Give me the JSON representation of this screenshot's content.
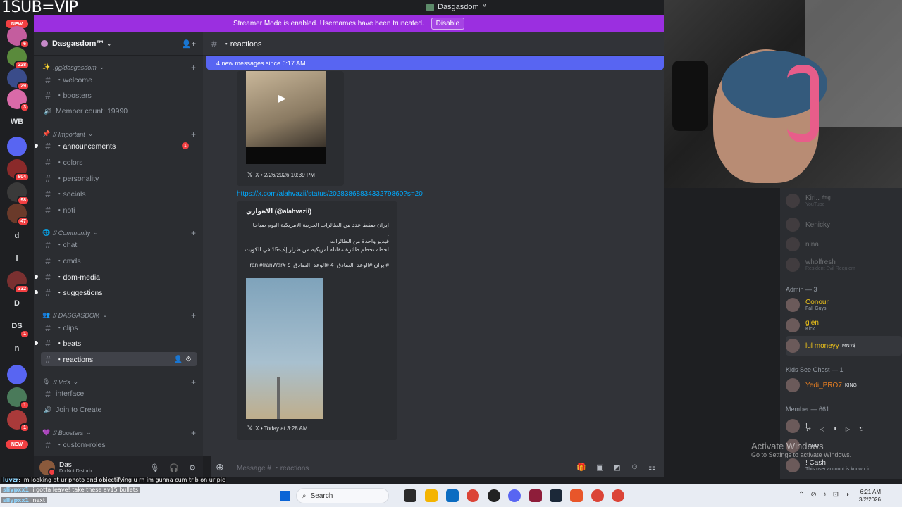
{
  "overlay": {
    "sub_text": "1SUB=VIP",
    "chat_lines": [
      {
        "user": "luvzr",
        "text": "im looking at ur photo and objectifying u rn im gunna cum trib on ur pic"
      },
      {
        "user": "sliypxx1",
        "text": "i gotta leave! take these av15 bullets"
      },
      {
        "user": "sliypxx1",
        "text": "next"
      }
    ]
  },
  "window": {
    "title": "Dasgasdom™"
  },
  "banner": {
    "text": "Streamer Mode is enabled. Usernames have been truncated.",
    "button": "Disable"
  },
  "rail": {
    "new_top": "NEW",
    "new_bottom": "NEW",
    "servers": [
      {
        "label": "",
        "badge": "6",
        "color": "#c45d9e"
      },
      {
        "label": "",
        "badge": "228",
        "color": "#5a8a3c"
      },
      {
        "label": "",
        "badge": "29",
        "color": "#3a4c8a"
      },
      {
        "label": "",
        "badge": "3",
        "color": "#d96aa8"
      },
      {
        "label": "WB",
        "badge": "",
        "color": "transparent"
      },
      {
        "label": "",
        "badge": "",
        "color": "#5865f2"
      },
      {
        "label": "",
        "badge": "804",
        "color": "#8a2a2a"
      },
      {
        "label": "",
        "badge": "98",
        "color": "#3a3a3a"
      },
      {
        "label": "",
        "badge": "47",
        "color": "#6a3a2a"
      },
      {
        "label": "d",
        "badge": "",
        "color": "transparent"
      },
      {
        "label": "l",
        "badge": "",
        "color": "transparent"
      },
      {
        "label": "",
        "badge": "332",
        "color": "#7a3030"
      },
      {
        "label": "D",
        "badge": "",
        "color": "transparent"
      },
      {
        "label": "DS",
        "badge": "1",
        "color": "transparent"
      },
      {
        "label": "n",
        "badge": "",
        "color": "transparent"
      },
      {
        "label": "",
        "badge": "",
        "color": "#5865f2"
      },
      {
        "label": "",
        "badge": "1",
        "color": "#4a7a5a"
      },
      {
        "label": "",
        "badge": "1",
        "color": "#aa3a3a"
      }
    ]
  },
  "guild": {
    "name": "Dasgasdom™",
    "categories": [
      {
        "name": ".gg/dasgasdom",
        "icon": "✨"
      },
      {
        "name": "// Important",
        "icon": "📌"
      },
      {
        "name": "// Community",
        "icon": "🌐"
      },
      {
        "name": "// DASGASDOM",
        "icon": "👥"
      },
      {
        "name": "// Vc's",
        "icon": "🎙"
      },
      {
        "name": "// Boosters",
        "icon": "💜"
      }
    ],
    "channels": [
      {
        "name": "・welcome",
        "type": "text"
      },
      {
        "name": "・boosters",
        "type": "text"
      },
      {
        "name": "Member count: 19990",
        "type": "voice"
      },
      {
        "name": "・announcements",
        "type": "text",
        "mention": "1"
      },
      {
        "name": "・colors",
        "type": "text"
      },
      {
        "name": "・personality",
        "type": "text"
      },
      {
        "name": "・socials",
        "type": "text"
      },
      {
        "name": "・noti",
        "type": "text"
      },
      {
        "name": "・chat",
        "type": "text"
      },
      {
        "name": "・cmds",
        "type": "text"
      },
      {
        "name": "・dom-media",
        "type": "text"
      },
      {
        "name": "・suggestions",
        "type": "text"
      },
      {
        "name": "・clips",
        "type": "text"
      },
      {
        "name": "・beats",
        "type": "text"
      },
      {
        "name": "・reactions",
        "type": "text"
      },
      {
        "name": "interface",
        "type": "text"
      },
      {
        "name": "Join to Create",
        "type": "voice"
      },
      {
        "name": "・custom-roles",
        "type": "text"
      }
    ]
  },
  "user": {
    "name": "Das",
    "status": "Do Not Disturb"
  },
  "channel": {
    "name": "・reactions",
    "new_messages": "4 new messages since 6:17 AM"
  },
  "chat": {
    "embed1_footer": "X • 2/26/2026 10:39 PM",
    "link": "https://x.com/alahvazii/status/2028386883433279860?s=20",
    "embed2_author": "الاهوازي (@alahvazii)",
    "embed2_lines": [
      "ايران صفط عدد من الطائرات الحربية الامريكية اليوم صباحا",
      ".",
      "فيديو واحدة من الطائرات",
      "لحظة تحطم طائرة مقاتلة أمريكية من طراز إف-15 في الكويت",
      ".",
      "#ايران #الوعد_الصادق_4 #الوعد_الصادق_٤ #Iran #IranWar"
    ],
    "embed2_footer": "X • Today at 3:28 AM",
    "composer_placeholder": "Message # ・reactions"
  },
  "members": {
    "top": [
      {
        "name": "Kiri..",
        "sub": "YouTube",
        "tag": "fmg",
        "color": "#dbdee1",
        "off": true
      },
      {
        "name": "Kenicky",
        "sub": "",
        "tag": "",
        "color": "#dbdee1",
        "off": true
      },
      {
        "name": "nina",
        "sub": "",
        "tag": "",
        "color": "#dbdee1",
        "off": true
      },
      {
        "name": "wholfresh",
        "sub": "Resident Evil Requiem",
        "tag": "",
        "color": "#dbdee1",
        "off": true
      }
    ],
    "admin_header": "Admin — 3",
    "admins": [
      {
        "name": "Conour",
        "sub": "Fall Guys",
        "tag": "",
        "color": "#f0c419"
      },
      {
        "name": "glen",
        "sub": "Kick",
        "tag": "",
        "color": "#f0c419"
      },
      {
        "name": "lul moneyy",
        "sub": "",
        "tag": "MNY$",
        "color": "#f0c419"
      }
    ],
    "ksg_header": "Kids See Ghost — 1",
    "ksg": [
      {
        "name": "Yedi_PRO7",
        "sub": "",
        "tag": "KING",
        "color": "#e67e22"
      }
    ],
    "member_header": "Member — 661",
    "member_rows": [
      {
        "name": "!",
        "sub": "",
        "tag": "",
        "color": "#dbdee1"
      },
      {
        "name": "",
        "sub": "",
        "tag": "XRD",
        "color": "#dbdee1"
      },
      {
        "name": "! Cash",
        "sub": "This user account is known fo",
        "tag": "",
        "color": "#dbdee1"
      }
    ]
  },
  "watermark": {
    "line1": "Activate Windows",
    "line2": "Go to Settings to activate Windows."
  },
  "taskbar": {
    "search": "Search",
    "time": "6:21 AM",
    "date": "3/2/2026"
  }
}
